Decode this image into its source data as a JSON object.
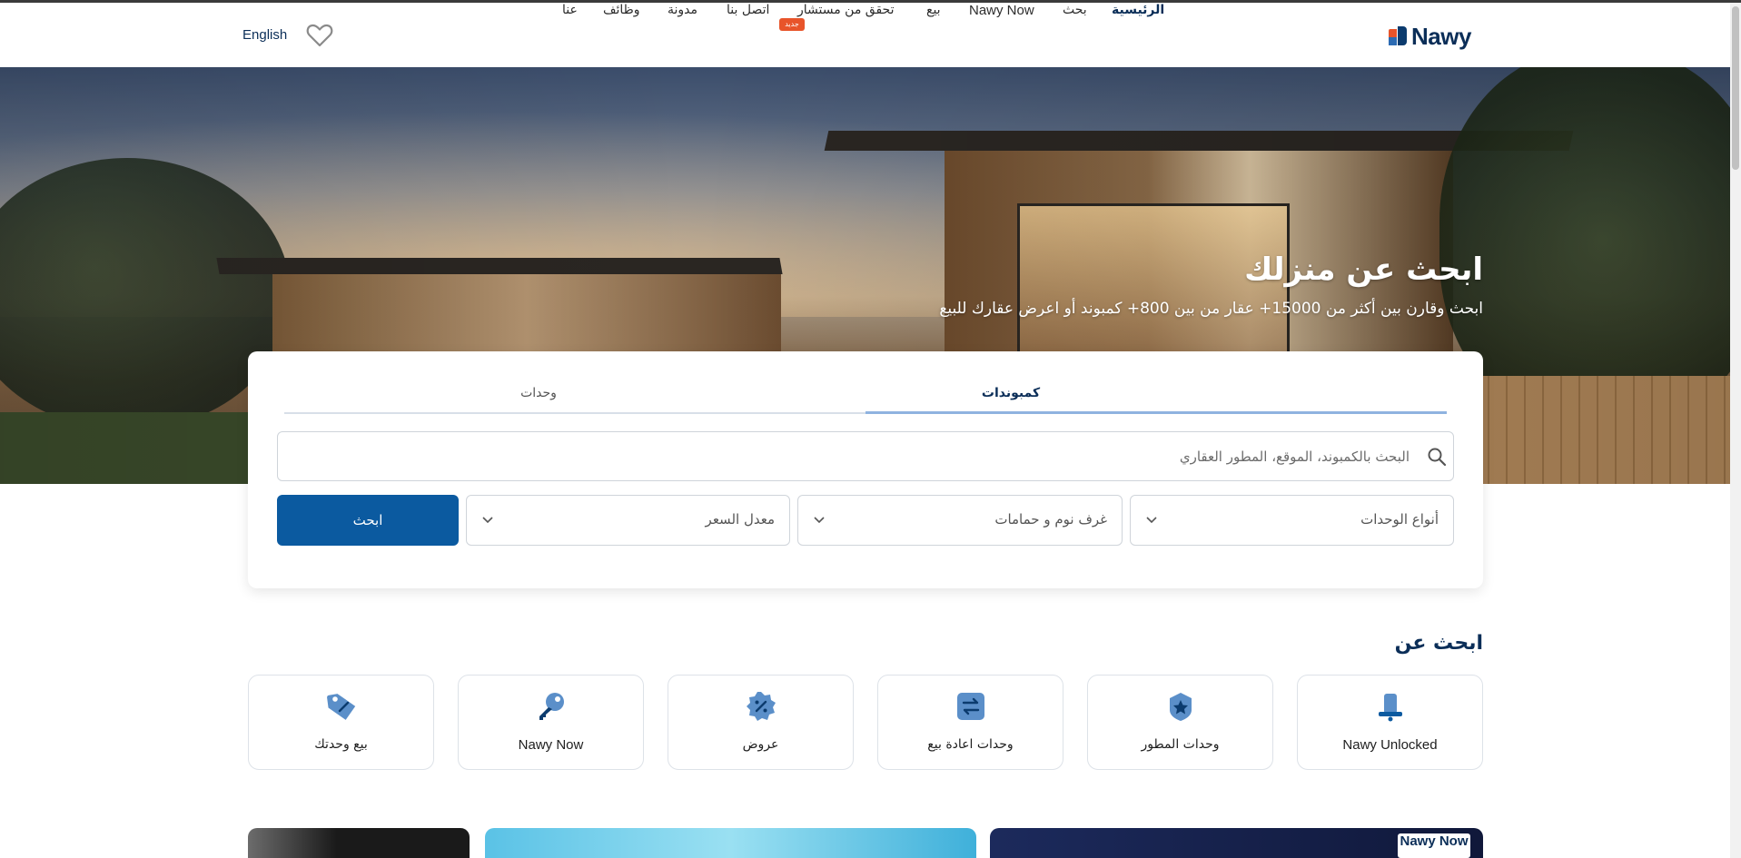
{
  "navbar": {
    "logo_text": "Nawy",
    "links": [
      {
        "label": "الرئيسية",
        "active": true
      },
      {
        "label": "بحث"
      },
      {
        "label": "Nawy Now"
      },
      {
        "label": "بيع"
      },
      {
        "label": "تحقق من مستشار"
      },
      {
        "label": "اتصل بنا"
      },
      {
        "label": "مدونة"
      },
      {
        "label": "وظائف"
      },
      {
        "label": "عنا"
      }
    ],
    "new_badge": "جديد",
    "language": "English",
    "favorites_icon": "heart-icon"
  },
  "hero": {
    "title": "ابحث عن منزلك",
    "subtitle": "ابحث وقارن بين أكثر من 15000+ عقار من بين 800+ كمبوند أو اعرض عقارك للبيع"
  },
  "search": {
    "tabs": [
      {
        "label": "كمبوندات",
        "active": true
      },
      {
        "label": "وحدات",
        "active": false
      }
    ],
    "placeholder": "البحث بالكمبوند، الموقع، المطور العقاري",
    "filters": {
      "unit_types": "أنواع الوحدات",
      "beds_baths": "غرف نوم و حمامات",
      "price_range": "معدل السعر"
    },
    "button_label": "ابحث"
  },
  "section": {
    "title": "ابحث عن",
    "cards": [
      {
        "label": "Nawy Unlocked",
        "icon": "bell-icon"
      },
      {
        "label": "وحدات المطور",
        "icon": "badge-star-icon"
      },
      {
        "label": "وحدات اعادة بيع",
        "icon": "swap-arrows-icon"
      },
      {
        "label": "عروض",
        "icon": "discount-icon"
      },
      {
        "label": "Nawy Now",
        "icon": "key-icon"
      },
      {
        "label": "بيع وحدتك",
        "icon": "price-tag-icon"
      }
    ]
  },
  "banners": {
    "banner1_logo": "Nawy Now"
  },
  "colors": {
    "brand_navy": "#0b2e58",
    "brand_orange": "#e8542a",
    "button_blue": "#0b5aa0",
    "icon_blue": "#5b8fc9"
  }
}
